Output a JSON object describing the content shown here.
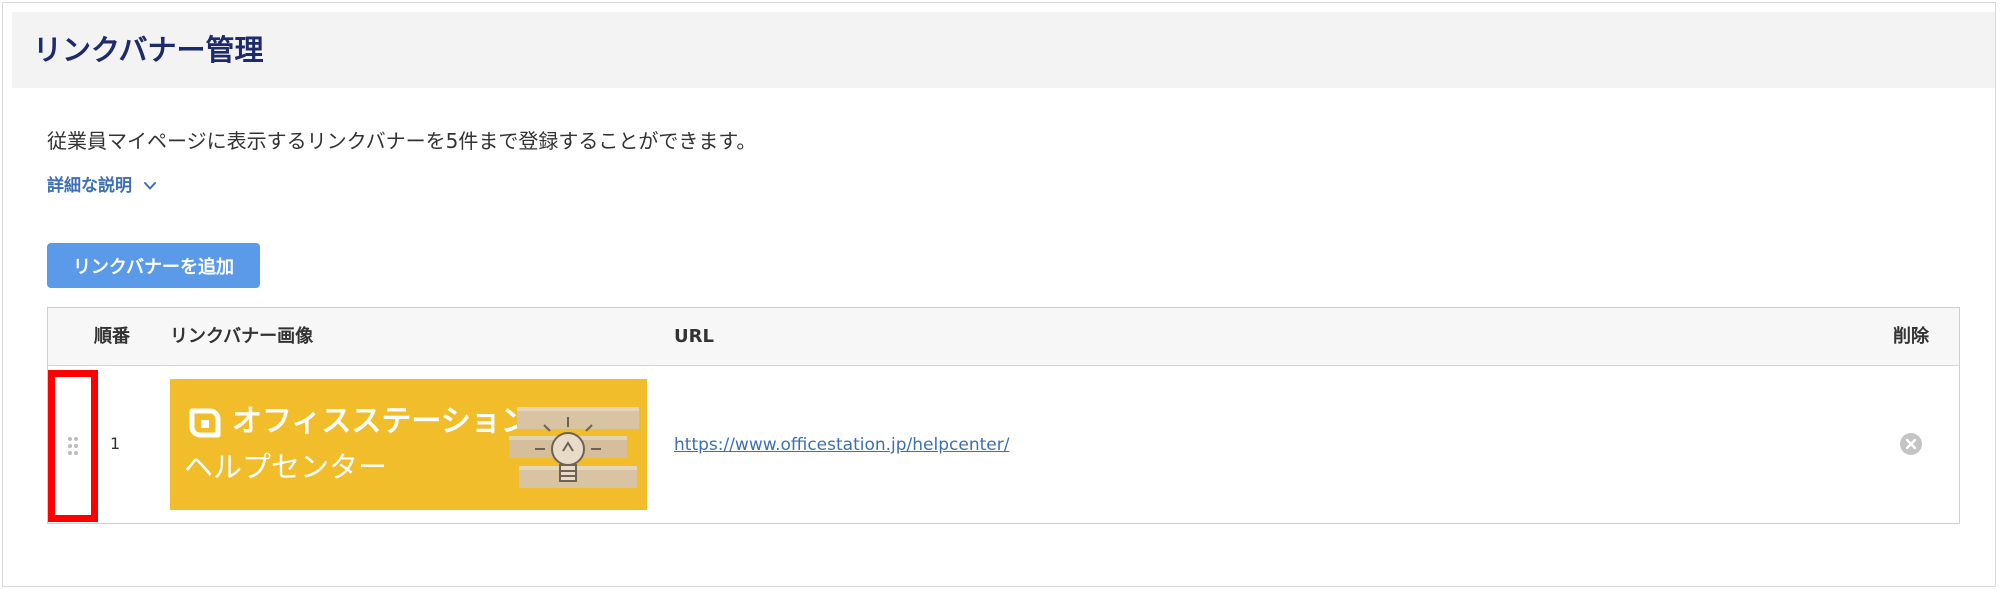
{
  "page": {
    "title": "リンクバナー管理",
    "description": "従業員マイページに表示するリンクバナーを5件まで登録することができます。",
    "details_toggle": "詳細な説明"
  },
  "toolbar": {
    "add_label": "リンクバナーを追加"
  },
  "table": {
    "headers": {
      "order": "順番",
      "image": "リンクバナー画像",
      "url": "URL",
      "delete": "削除"
    },
    "rows": [
      {
        "order": "1",
        "banner": {
          "line1": "オフィスステーション",
          "line2": "ヘルプセンター"
        },
        "url": "https://www.officestation.jp/helpcenter/"
      }
    ]
  },
  "colors": {
    "title": "#1d2a6b",
    "link": "#3d6fb5",
    "add_button": "#5b9ae8",
    "banner_bg": "#f2bd2a",
    "highlight": "#ff0000"
  },
  "icons": {
    "toggle": "chevron-down-icon",
    "drag": "drag-handle-icon",
    "delete": "close-circle-icon",
    "banner_logo": "officestation-logo-icon",
    "banner_art": "lightbulb-blocks-icon"
  }
}
